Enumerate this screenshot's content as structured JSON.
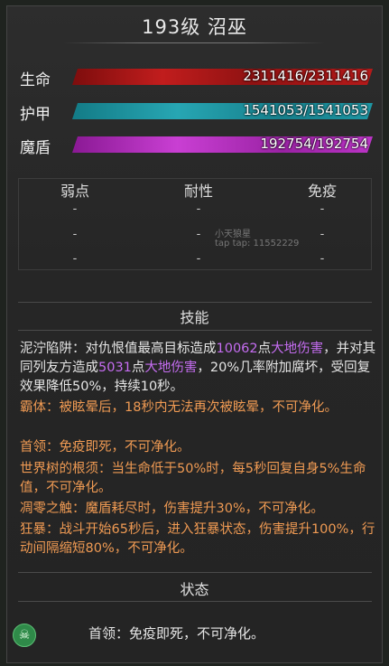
{
  "header": {
    "title": "193级 沼巫"
  },
  "stats": {
    "hp": {
      "label": "生命",
      "value": "2311416/2311416",
      "fill": 1.0,
      "color": "#c11d1d"
    },
    "armor": {
      "label": "护甲",
      "value": "1541053/1541053",
      "fill": 1.0,
      "color": "#27a6b3"
    },
    "shield": {
      "label": "魔盾",
      "value": "192754/192754",
      "fill": 1.0,
      "color": "#c93fd3"
    }
  },
  "resistances": {
    "headers": [
      "弱点",
      "耐性",
      "免疫"
    ],
    "rows": [
      [
        "-",
        "-",
        "-"
      ],
      [
        "-",
        "-",
        "-"
      ],
      [
        "-",
        "-",
        "-"
      ]
    ]
  },
  "watermark": {
    "line1": "小天狼星",
    "line2": "tap tap: 11552229"
  },
  "skills": {
    "title": "技能",
    "s1": {
      "a": "泥泞陷阱：对仇恨值最高目标造成",
      "b": "10062",
      "c": "点",
      "d": "大地伤害",
      "e": "，并对其同列友方造成",
      "f": "5031",
      "g": "点",
      "h": "大地伤害",
      "i": "，20%几率附加腐坏，受回复效果降低50%，持续10秒。"
    },
    "s2": "霸体：被眩晕后，18秒内无法再次被眩晕，不可净化。",
    "s3": "首领：免疫即死，不可净化。",
    "s4": "世界树的根须：当生命低于50%时，每5秒回复自身5%生命值，不可净化。",
    "s5": "凋零之触：魔盾耗尽时，伤害提升30%，不可净化。",
    "s6": "狂暴：战斗开始65秒后，进入狂暴状态，伤害提升100%，行动间隔缩短80%，不可净化。"
  },
  "status": {
    "title": "状态",
    "icon": "skull-icon",
    "text": "首领：免疫即死，不可净化。"
  }
}
